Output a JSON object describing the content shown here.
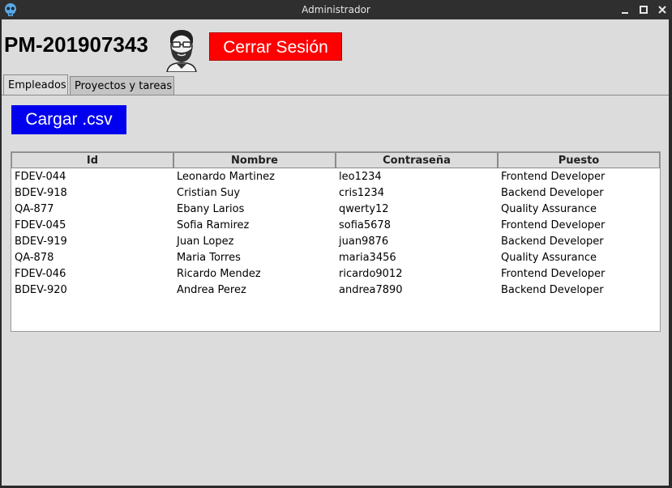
{
  "window": {
    "title": "Administrador"
  },
  "header": {
    "user_code": "PM-201907343",
    "logout_label": "Cerrar Sesión"
  },
  "tabs": [
    {
      "label": "Empleados",
      "active": true
    },
    {
      "label": "Proyectos y tareas",
      "active": false
    }
  ],
  "actions": {
    "load_csv_label": "Cargar .csv"
  },
  "colors": {
    "logout_bg": "#ff0000",
    "csv_bg": "#0000ee"
  },
  "icons": {
    "app": "skull-icon",
    "avatar": "bearded-man-avatar-icon",
    "minimize": "minimize-icon",
    "maximize": "maximize-icon",
    "close": "close-icon"
  },
  "table": {
    "columns": [
      "Id",
      "Nombre",
      "Contraseña",
      "Puesto"
    ],
    "rows": [
      [
        "FDEV-044",
        "Leonardo Martinez",
        "leo1234",
        "Frontend Developer"
      ],
      [
        "BDEV-918",
        "Cristian Suy",
        "cris1234",
        "Backend Developer"
      ],
      [
        "QA-877",
        "Ebany Larios",
        "qwerty12",
        "Quality Assurance"
      ],
      [
        "FDEV-045",
        "Sofia Ramirez",
        "sofia5678",
        "Frontend Developer"
      ],
      [
        "BDEV-919",
        "Juan Lopez",
        "juan9876",
        "Backend Developer"
      ],
      [
        "QA-878",
        "Maria Torres",
        "maria3456",
        "Quality Assurance"
      ],
      [
        "FDEV-046",
        "Ricardo Mendez",
        "ricardo9012",
        "Frontend Developer"
      ],
      [
        "BDEV-920",
        "Andrea Perez",
        "andrea7890",
        "Backend Developer"
      ]
    ]
  }
}
